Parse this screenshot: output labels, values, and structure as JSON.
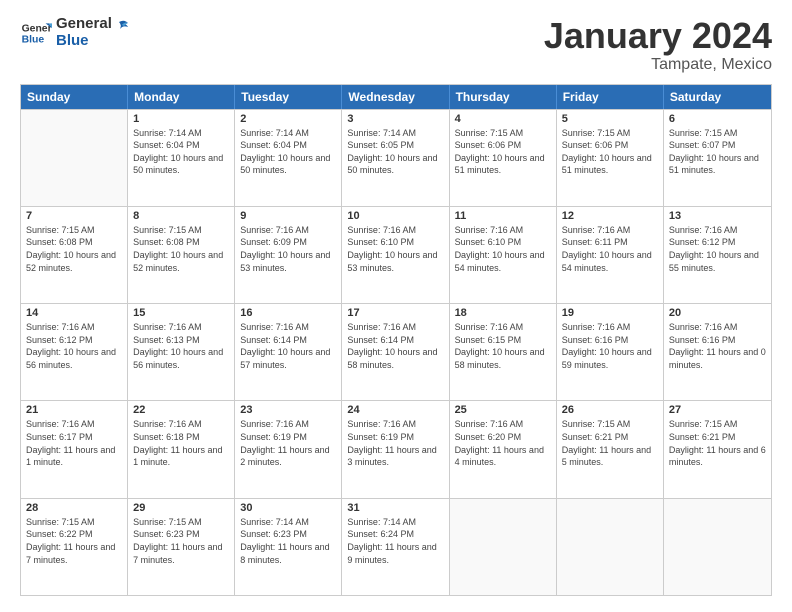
{
  "logo": {
    "line1": "General",
    "line2": "Blue"
  },
  "title": "January 2024",
  "subtitle": "Tampate, Mexico",
  "header_days": [
    "Sunday",
    "Monday",
    "Tuesday",
    "Wednesday",
    "Thursday",
    "Friday",
    "Saturday"
  ],
  "weeks": [
    [
      {
        "day": "",
        "empty": true
      },
      {
        "day": "1",
        "sunrise": "Sunrise: 7:14 AM",
        "sunset": "Sunset: 6:04 PM",
        "daylight": "Daylight: 10 hours and 50 minutes."
      },
      {
        "day": "2",
        "sunrise": "Sunrise: 7:14 AM",
        "sunset": "Sunset: 6:04 PM",
        "daylight": "Daylight: 10 hours and 50 minutes."
      },
      {
        "day": "3",
        "sunrise": "Sunrise: 7:14 AM",
        "sunset": "Sunset: 6:05 PM",
        "daylight": "Daylight: 10 hours and 50 minutes."
      },
      {
        "day": "4",
        "sunrise": "Sunrise: 7:15 AM",
        "sunset": "Sunset: 6:06 PM",
        "daylight": "Daylight: 10 hours and 51 minutes."
      },
      {
        "day": "5",
        "sunrise": "Sunrise: 7:15 AM",
        "sunset": "Sunset: 6:06 PM",
        "daylight": "Daylight: 10 hours and 51 minutes."
      },
      {
        "day": "6",
        "sunrise": "Sunrise: 7:15 AM",
        "sunset": "Sunset: 6:07 PM",
        "daylight": "Daylight: 10 hours and 51 minutes."
      }
    ],
    [
      {
        "day": "7",
        "sunrise": "Sunrise: 7:15 AM",
        "sunset": "Sunset: 6:08 PM",
        "daylight": "Daylight: 10 hours and 52 minutes."
      },
      {
        "day": "8",
        "sunrise": "Sunrise: 7:15 AM",
        "sunset": "Sunset: 6:08 PM",
        "daylight": "Daylight: 10 hours and 52 minutes."
      },
      {
        "day": "9",
        "sunrise": "Sunrise: 7:16 AM",
        "sunset": "Sunset: 6:09 PM",
        "daylight": "Daylight: 10 hours and 53 minutes."
      },
      {
        "day": "10",
        "sunrise": "Sunrise: 7:16 AM",
        "sunset": "Sunset: 6:10 PM",
        "daylight": "Daylight: 10 hours and 53 minutes."
      },
      {
        "day": "11",
        "sunrise": "Sunrise: 7:16 AM",
        "sunset": "Sunset: 6:10 PM",
        "daylight": "Daylight: 10 hours and 54 minutes."
      },
      {
        "day": "12",
        "sunrise": "Sunrise: 7:16 AM",
        "sunset": "Sunset: 6:11 PM",
        "daylight": "Daylight: 10 hours and 54 minutes."
      },
      {
        "day": "13",
        "sunrise": "Sunrise: 7:16 AM",
        "sunset": "Sunset: 6:12 PM",
        "daylight": "Daylight: 10 hours and 55 minutes."
      }
    ],
    [
      {
        "day": "14",
        "sunrise": "Sunrise: 7:16 AM",
        "sunset": "Sunset: 6:12 PM",
        "daylight": "Daylight: 10 hours and 56 minutes."
      },
      {
        "day": "15",
        "sunrise": "Sunrise: 7:16 AM",
        "sunset": "Sunset: 6:13 PM",
        "daylight": "Daylight: 10 hours and 56 minutes."
      },
      {
        "day": "16",
        "sunrise": "Sunrise: 7:16 AM",
        "sunset": "Sunset: 6:14 PM",
        "daylight": "Daylight: 10 hours and 57 minutes."
      },
      {
        "day": "17",
        "sunrise": "Sunrise: 7:16 AM",
        "sunset": "Sunset: 6:14 PM",
        "daylight": "Daylight: 10 hours and 58 minutes."
      },
      {
        "day": "18",
        "sunrise": "Sunrise: 7:16 AM",
        "sunset": "Sunset: 6:15 PM",
        "daylight": "Daylight: 10 hours and 58 minutes."
      },
      {
        "day": "19",
        "sunrise": "Sunrise: 7:16 AM",
        "sunset": "Sunset: 6:16 PM",
        "daylight": "Daylight: 10 hours and 59 minutes."
      },
      {
        "day": "20",
        "sunrise": "Sunrise: 7:16 AM",
        "sunset": "Sunset: 6:16 PM",
        "daylight": "Daylight: 11 hours and 0 minutes."
      }
    ],
    [
      {
        "day": "21",
        "sunrise": "Sunrise: 7:16 AM",
        "sunset": "Sunset: 6:17 PM",
        "daylight": "Daylight: 11 hours and 1 minute."
      },
      {
        "day": "22",
        "sunrise": "Sunrise: 7:16 AM",
        "sunset": "Sunset: 6:18 PM",
        "daylight": "Daylight: 11 hours and 1 minute."
      },
      {
        "day": "23",
        "sunrise": "Sunrise: 7:16 AM",
        "sunset": "Sunset: 6:19 PM",
        "daylight": "Daylight: 11 hours and 2 minutes."
      },
      {
        "day": "24",
        "sunrise": "Sunrise: 7:16 AM",
        "sunset": "Sunset: 6:19 PM",
        "daylight": "Daylight: 11 hours and 3 minutes."
      },
      {
        "day": "25",
        "sunrise": "Sunrise: 7:16 AM",
        "sunset": "Sunset: 6:20 PM",
        "daylight": "Daylight: 11 hours and 4 minutes."
      },
      {
        "day": "26",
        "sunrise": "Sunrise: 7:15 AM",
        "sunset": "Sunset: 6:21 PM",
        "daylight": "Daylight: 11 hours and 5 minutes."
      },
      {
        "day": "27",
        "sunrise": "Sunrise: 7:15 AM",
        "sunset": "Sunset: 6:21 PM",
        "daylight": "Daylight: 11 hours and 6 minutes."
      }
    ],
    [
      {
        "day": "28",
        "sunrise": "Sunrise: 7:15 AM",
        "sunset": "Sunset: 6:22 PM",
        "daylight": "Daylight: 11 hours and 7 minutes."
      },
      {
        "day": "29",
        "sunrise": "Sunrise: 7:15 AM",
        "sunset": "Sunset: 6:23 PM",
        "daylight": "Daylight: 11 hours and 7 minutes."
      },
      {
        "day": "30",
        "sunrise": "Sunrise: 7:14 AM",
        "sunset": "Sunset: 6:23 PM",
        "daylight": "Daylight: 11 hours and 8 minutes."
      },
      {
        "day": "31",
        "sunrise": "Sunrise: 7:14 AM",
        "sunset": "Sunset: 6:24 PM",
        "daylight": "Daylight: 11 hours and 9 minutes."
      },
      {
        "day": "",
        "empty": true
      },
      {
        "day": "",
        "empty": true
      },
      {
        "day": "",
        "empty": true
      }
    ]
  ]
}
